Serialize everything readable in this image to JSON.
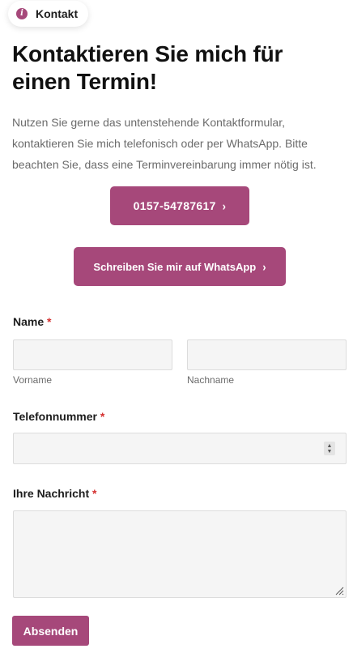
{
  "badge": {
    "label": "Kontakt",
    "icon": "info-icon"
  },
  "title": "Kontaktieren Sie mich für einen Termin!",
  "intro": "Nutzen Sie gerne das untenstehende Kontaktformular, kontaktieren Sie mich telefonisch oder per WhatsApp. Bitte beachten Sie, dass eine Terminvereinbarung immer nötig ist.",
  "buttons": {
    "phone": "0157-54787617",
    "whatsapp": "Schreiben Sie mir auf WhatsApp",
    "chevron": "›"
  },
  "form": {
    "name_label": "Name",
    "required_mark": "*",
    "first_name_sub": "Vorname",
    "last_name_sub": "Nachname",
    "first_name_value": "",
    "last_name_value": "",
    "phone_label": "Telefonnummer",
    "phone_value": "",
    "message_label": "Ihre Nachricht",
    "message_value": "",
    "submit": "Absenden"
  },
  "colors": {
    "accent": "#a6487a",
    "required": "#d4302f",
    "input_bg": "#f5f5f5"
  }
}
